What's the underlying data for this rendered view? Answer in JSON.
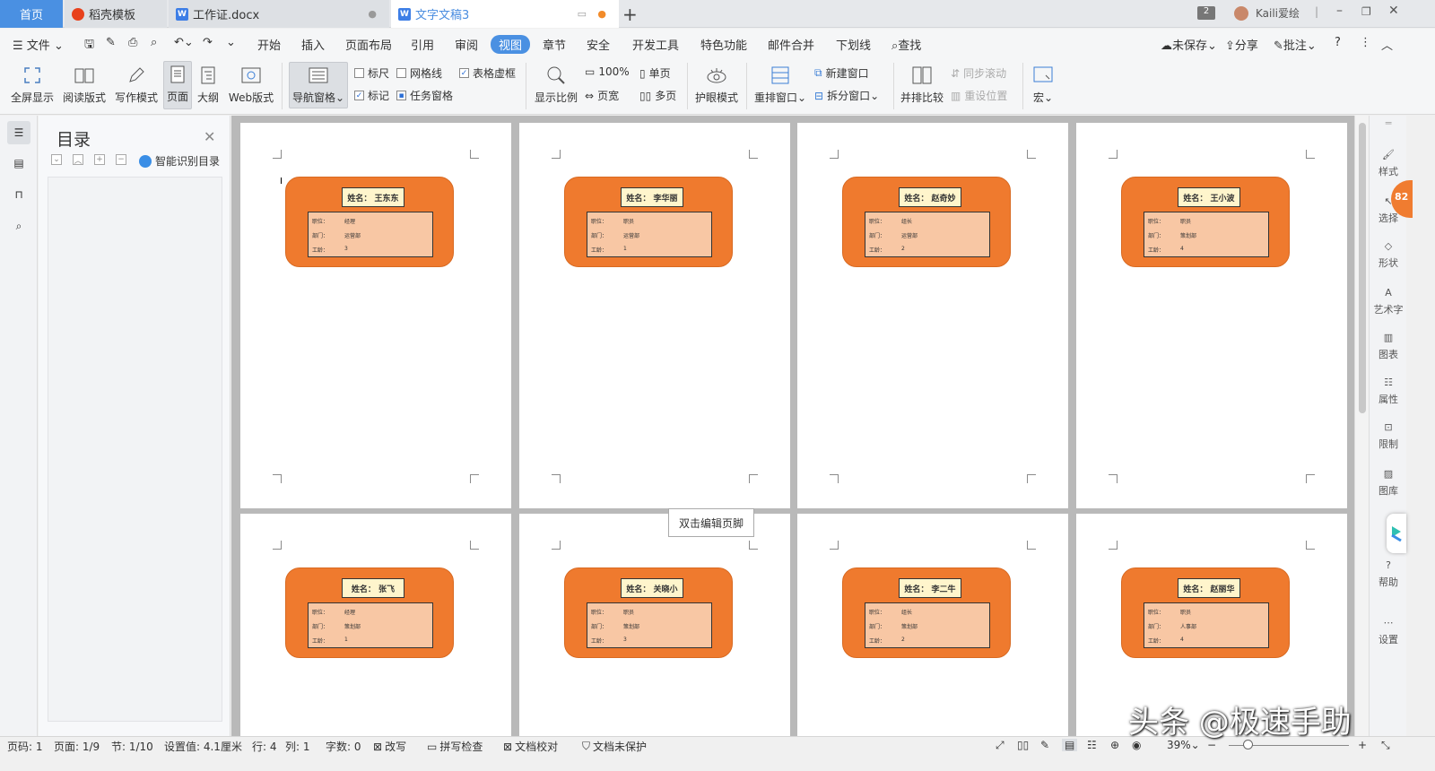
{
  "tabs": {
    "home": "首页",
    "t1": "稻壳模板",
    "t2": "工作证.docx",
    "t3": "文字文稿3",
    "new_tab": "+",
    "badge_count": "2",
    "user": "Kaili爱绘"
  },
  "menu": {
    "file": "文件",
    "items": [
      "开始",
      "插入",
      "页面布局",
      "引用",
      "审阅",
      "视图",
      "章节",
      "安全",
      "开发工具",
      "特色功能",
      "邮件合并",
      "下划线"
    ],
    "active": "视图",
    "search": "查找",
    "unsaved": "未保存",
    "share": "分享",
    "comment": "批注",
    "help": "?"
  },
  "ribbon": {
    "fullscreen": "全屏显示",
    "read_mode": "阅读版式",
    "write_mode": "写作模式",
    "page": "页面",
    "outline": "大纲",
    "web": "Web版式",
    "nav_pane": "导航窗格",
    "ruler": "标尺",
    "gridline": "网格线",
    "table_frame": "表格虚框",
    "mark": "标记",
    "task_pane": "任务窗格",
    "zoom_ratio": "显示比例",
    "zoom100": "100%",
    "page_width": "页宽",
    "single_page": "单页",
    "multi_page": "多页",
    "eye_mode": "护眼模式",
    "rearrange": "重排窗口",
    "new_window": "新建窗口",
    "split_window": "拆分窗口",
    "side_by_side": "并排比较",
    "sync_scroll": "同步滚动",
    "reset_pos": "重设位置",
    "macro": "宏"
  },
  "navpane": {
    "title": "目录",
    "smart": "智能识别目录"
  },
  "badge_labels": {
    "post": "职位：",
    "dept": "部门：",
    "years": "工龄："
  },
  "cards": [
    {
      "name": "姓名： 王东东",
      "post": "经理",
      "dept": "运营部",
      "years": "3"
    },
    {
      "name": "姓名： 李华丽",
      "post": "职员",
      "dept": "运营部",
      "years": "1"
    },
    {
      "name": "姓名： 赵奇妙",
      "post": "组长",
      "dept": "运营部",
      "years": "2"
    },
    {
      "name": "姓名： 王小波",
      "post": "职员",
      "dept": "策划部",
      "years": "4"
    },
    {
      "name": "姓名： 张飞",
      "post": "经理",
      "dept": "策划部",
      "years": "1"
    },
    {
      "name": "姓名： 关晓小",
      "post": "职员",
      "dept": "策划部",
      "years": "3"
    },
    {
      "name": "姓名： 李二牛",
      "post": "组长",
      "dept": "策划部",
      "years": "2"
    },
    {
      "name": "姓名： 赵丽华",
      "post": "职员",
      "dept": "人事部",
      "years": "4"
    }
  ],
  "footer_tip": "双击编辑页脚",
  "right_panel": [
    "样式",
    "选择",
    "形状",
    "艺术字",
    "图表",
    "属性",
    "限制",
    "图库",
    "",
    "帮助",
    "设置"
  ],
  "orb_count": "82",
  "status": {
    "page_no": "页码: 1",
    "pages": "页面: 1/9",
    "section": "节: 1/10",
    "setting": "设置值: 4.1厘米",
    "row": "行: 4",
    "col": "列: 1",
    "words": "字数: 0",
    "revise": "改写",
    "spell": "拼写检查",
    "proof": "文档校对",
    "protect": "文档未保护",
    "zoom": "39%"
  },
  "watermark": "头条 @极速手助",
  "colors": {
    "accent": "#4a90e2",
    "badge": "#ef7a2e",
    "info": "#f8c7a4",
    "namebox": "#fff5cc"
  }
}
